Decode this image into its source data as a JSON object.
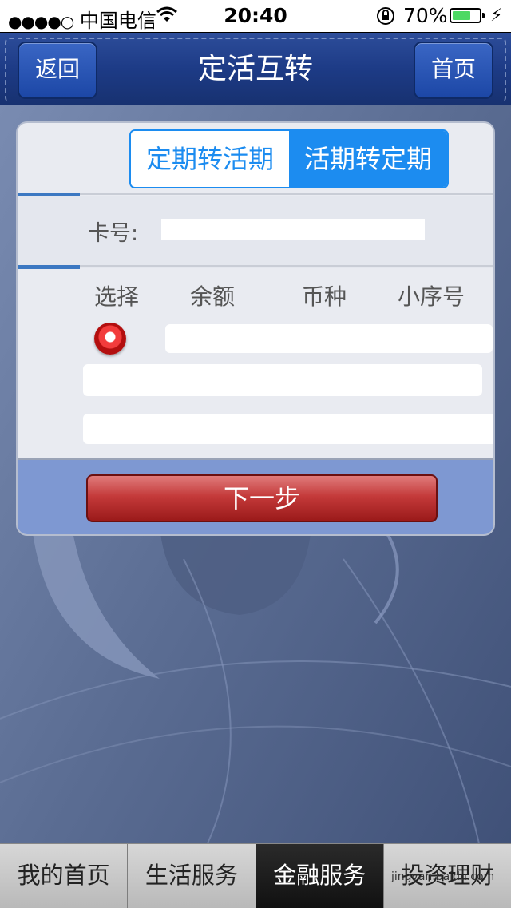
{
  "status_bar": {
    "signal": "●●●●○",
    "carrier": "中国电信",
    "time": "20:40",
    "battery_percent": "70%",
    "battery_level": 0.7
  },
  "nav": {
    "back_label": "返回",
    "title": "定活互转",
    "home_label": "首页"
  },
  "segment": {
    "options": [
      "定期转活期",
      "活期转定期"
    ],
    "selected_index": 1
  },
  "form": {
    "card_label": "卡号:"
  },
  "table": {
    "headers": [
      "选择",
      "余额",
      "币种",
      "小序号"
    ]
  },
  "next_button": "下一步",
  "tabs": {
    "items": [
      "我的首页",
      "生活服务",
      "金融服务",
      "投资理财"
    ],
    "active_index": 2
  },
  "watermark": "jingyan.baidu.com",
  "colors": {
    "accent_blue": "#1c8cf0",
    "nav_blue": "#1d3b86",
    "button_red": "#c43a3a"
  }
}
